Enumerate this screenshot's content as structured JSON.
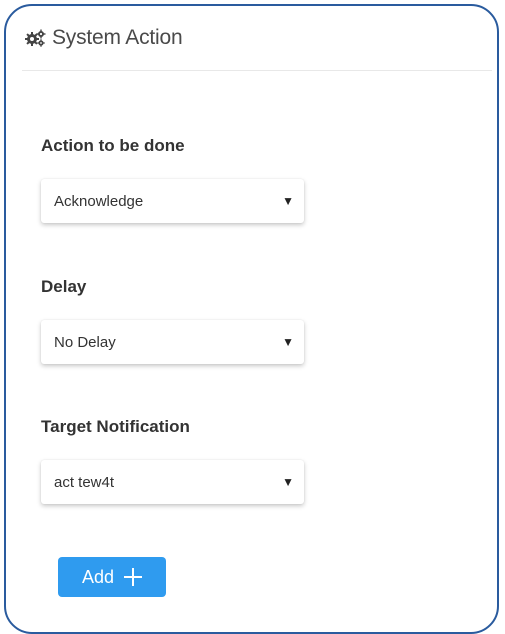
{
  "panel": {
    "title": "System Action",
    "title_icon": "gears-icon"
  },
  "fields": {
    "action": {
      "label": "Action to be done",
      "selected": "Acknowledge"
    },
    "delay": {
      "label": "Delay",
      "selected": "No Delay"
    },
    "target": {
      "label": "Target Notification",
      "selected": "act tew4t"
    }
  },
  "add_button": {
    "label": "Add",
    "icon": "plus-icon",
    "color": "#2f9bef"
  },
  "colors": {
    "border": "#2a5b9e"
  }
}
